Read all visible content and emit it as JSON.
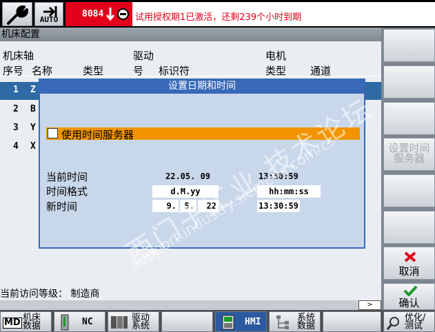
{
  "topbar": {
    "mode_label": "AUTO",
    "alarm_code": "8084",
    "alarm_text": "试用授权期1已激活，还剩239个小时到期"
  },
  "main": {
    "section_title": "机床配置",
    "headers": {
      "machine_axis": "机床轴",
      "index": "序号",
      "name": "名称",
      "type": "类型",
      "drive": "驱动",
      "drive_no": "号",
      "identifier": "标识符",
      "motor": "电机",
      "motor_type": "类型",
      "channel": "通道"
    },
    "axes": [
      {
        "index": "1",
        "name": "Z"
      },
      {
        "index": "2",
        "name": "B"
      },
      {
        "index": "3",
        "name": "Y"
      },
      {
        "index": "4",
        "name": "X"
      }
    ],
    "access_level": "当前访问等级： 制造商",
    "scroll_indicator": ">"
  },
  "dialog": {
    "title": "设置日期和时间",
    "timeserver_label": "使用时间服务器",
    "timeserver_checked": false,
    "current_time_label": "当前时间",
    "current_date": "22.05.  09",
    "current_time": "13:30:59",
    "format_label": "时间格式",
    "date_format": "d.M.yy",
    "time_format": "hh:mm:ss",
    "new_time_label": "新时间",
    "new_day": "9.",
    "new_month": "5.",
    "new_year": "22",
    "new_time": "13:30:59"
  },
  "watermark": {
    "line1": "西门子工业 技术论坛",
    "line2": "support.industry.siemens.com/cs"
  },
  "softkeys_right": {
    "timeserver": "设置时间\n服务器",
    "cancel": "取消",
    "ok": "确认"
  },
  "softkeys_bottom": {
    "machine_data_icon": "MD",
    "machine_data": "机床\n数据",
    "nc": "NC",
    "drive_system": "驱动\n系统",
    "hmi": "HMI",
    "system_data": "系统\n数据",
    "optimize_test": "优化/\n测试"
  },
  "colors": {
    "alarm_red": "#e3001b",
    "dialog_blue": "#3868b8",
    "highlight_orange": "#f29400",
    "selected_row": "#2f6aa6"
  }
}
